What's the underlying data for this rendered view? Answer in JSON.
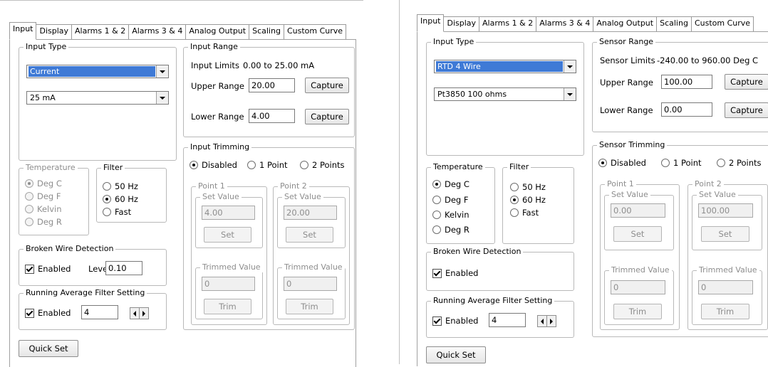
{
  "left": {
    "tabs": [
      "Input",
      "Display",
      "Alarms 1 & 2",
      "Alarms 3 & 4",
      "Analog Output",
      "Scaling",
      "Custom Curve"
    ],
    "input_type": {
      "legend": "Input Type",
      "type_value": "Current",
      "subtype_value": "25 mA"
    },
    "input_range": {
      "legend": "Input Range",
      "limits_label": "Input Limits",
      "limits_value": "0.00 to 25.00 mA",
      "upper_label": "Upper Range",
      "upper_value": "20.00",
      "lower_label": "Lower Range",
      "lower_value": "4.00",
      "capture_label": "Capture"
    },
    "temperature": {
      "legend": "Temperature",
      "options": [
        "Deg C",
        "Deg F",
        "Kelvin",
        "Deg R"
      ]
    },
    "filter": {
      "legend": "Filter",
      "options": [
        "50 Hz",
        "60 Hz",
        "Fast"
      ]
    },
    "trimming": {
      "legend": "Input Trimming",
      "options": [
        "Disabled",
        "1 Point",
        "2 Points"
      ],
      "point1": {
        "legend": "Point 1",
        "set_value_legend": "Set Value",
        "set_value": "4.00",
        "set_label": "Set",
        "trimmed_legend": "Trimmed Value",
        "trimmed_value": "0",
        "trim_label": "Trim"
      },
      "point2": {
        "legend": "Point 2",
        "set_value_legend": "Set Value",
        "set_value": "20.00",
        "set_label": "Set",
        "trimmed_legend": "Trimmed Value",
        "trimmed_value": "0",
        "trim_label": "Trim"
      }
    },
    "broken_wire": {
      "legend": "Broken Wire Detection",
      "enabled_label": "Enabled",
      "level_label": "Level",
      "level_value": "0.10"
    },
    "running_avg": {
      "legend": "Running Average Filter Setting",
      "enabled_label": "Enabled",
      "value": "4"
    },
    "quick_set_label": "Quick Set"
  },
  "right": {
    "tabs": [
      "Input",
      "Display",
      "Alarms 1 & 2",
      "Alarms 3 & 4",
      "Analog Output",
      "Scaling",
      "Custom Curve"
    ],
    "input_type": {
      "legend": "Input Type",
      "type_value": "RTD 4 Wire",
      "subtype_value": "Pt3850 100 ohms"
    },
    "sensor_range": {
      "legend": "Sensor Range",
      "limits_label": "Sensor Limits",
      "limits_value": "-240.00 to 960.00 Deg C",
      "upper_label": "Upper Range",
      "upper_value": "100.00",
      "lower_label": "Lower Range",
      "lower_value": "0.00",
      "capture_label": "Capture"
    },
    "temperature": {
      "legend": "Temperature",
      "options": [
        "Deg C",
        "Deg F",
        "Kelvin",
        "Deg R"
      ]
    },
    "filter": {
      "legend": "Filter",
      "options": [
        "50 Hz",
        "60 Hz",
        "Fast"
      ]
    },
    "trimming": {
      "legend": "Sensor Trimming",
      "options": [
        "Disabled",
        "1 Point",
        "2 Points"
      ],
      "point1": {
        "legend": "Point 1",
        "set_value_legend": "Set Value",
        "set_value": "0.00",
        "set_label": "Set",
        "trimmed_legend": "Trimmed Value",
        "trimmed_value": "0",
        "trim_label": "Trim"
      },
      "point2": {
        "legend": "Point 2",
        "set_value_legend": "Set Value",
        "set_value": "100.00",
        "set_label": "Set",
        "trimmed_legend": "Trimmed Value",
        "trimmed_value": "0",
        "trim_label": "Trim"
      }
    },
    "broken_wire": {
      "legend": "Broken Wire Detection",
      "enabled_label": "Enabled"
    },
    "running_avg": {
      "legend": "Running Average Filter Setting",
      "enabled_label": "Enabled",
      "value": "4"
    },
    "quick_set_label": "Quick Set"
  }
}
